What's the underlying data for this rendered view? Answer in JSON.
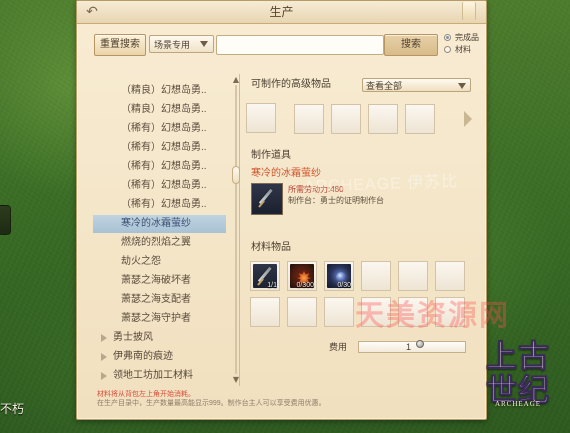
{
  "window": {
    "title": "生产"
  },
  "filters": {
    "reset_search_label": "重置搜索",
    "scene_select_label": "场景专用",
    "search_input_value": "",
    "search_button_label": "搜索",
    "result_type_options": [
      "完成品",
      "材料"
    ],
    "result_type_selected": "完成品"
  },
  "recipe_list": {
    "items": [
      {
        "label": "（精良）幻想岛勇..",
        "kind": "item",
        "selected": false
      },
      {
        "label": "（精良）幻想岛勇..",
        "kind": "item",
        "selected": false
      },
      {
        "label": "（稀有）幻想岛勇..",
        "kind": "item",
        "selected": false
      },
      {
        "label": "（稀有）幻想岛勇..",
        "kind": "item",
        "selected": false
      },
      {
        "label": "（稀有）幻想岛勇..",
        "kind": "item",
        "selected": false
      },
      {
        "label": "（稀有）幻想岛勇..",
        "kind": "item",
        "selected": false
      },
      {
        "label": "（稀有）幻想岛勇..",
        "kind": "item",
        "selected": false
      },
      {
        "label": "寒冷的冰霜萤纱",
        "kind": "item",
        "selected": true
      },
      {
        "label": "燃烧的烈焰之翼",
        "kind": "item",
        "selected": false
      },
      {
        "label": "劫火之怨",
        "kind": "item",
        "selected": false
      },
      {
        "label": "萧瑟之海破坏者",
        "kind": "item",
        "selected": false
      },
      {
        "label": "萧瑟之海支配者",
        "kind": "item",
        "selected": false
      },
      {
        "label": "萧瑟之海守护者",
        "kind": "item",
        "selected": false
      },
      {
        "label": "勇士披风",
        "kind": "group",
        "selected": false
      },
      {
        "label": "伊弗南的痕迹",
        "kind": "group",
        "selected": false
      },
      {
        "label": "领地工坊加工材料",
        "kind": "group",
        "selected": false
      }
    ]
  },
  "right_panel": {
    "available_title": "可制作的高级物品",
    "view_filter": "查看全部",
    "tool_title": "制作道具",
    "tool_name": "寒冷的冰霜萤纱",
    "labor_required": "所需劳动力:480",
    "crafting_station": "制作台：勇士的证明制作台",
    "material_title": "材料物品",
    "fee_label": "费用",
    "fee_value": "1"
  },
  "materials": [
    {
      "icon": "sword-icon",
      "count": "1/1"
    },
    {
      "icon": "leaf-icon",
      "count": "0/300"
    },
    {
      "icon": "orb-icon",
      "count": "0/30"
    }
  ],
  "footer": {
    "line1": "材料将从背包左上角开始消耗。",
    "line2": "在生产目录中，生产数量最高能显示999。制作台主人可以享受费用优惠。"
  },
  "overlays": {
    "bottom_left_text": "不朽",
    "center_watermark": "ARCHEAGE 伊苏比",
    "corner_watermark": "天美资源网",
    "logo_main": "上古世纪",
    "logo_sub": "ARCHEAGE"
  }
}
